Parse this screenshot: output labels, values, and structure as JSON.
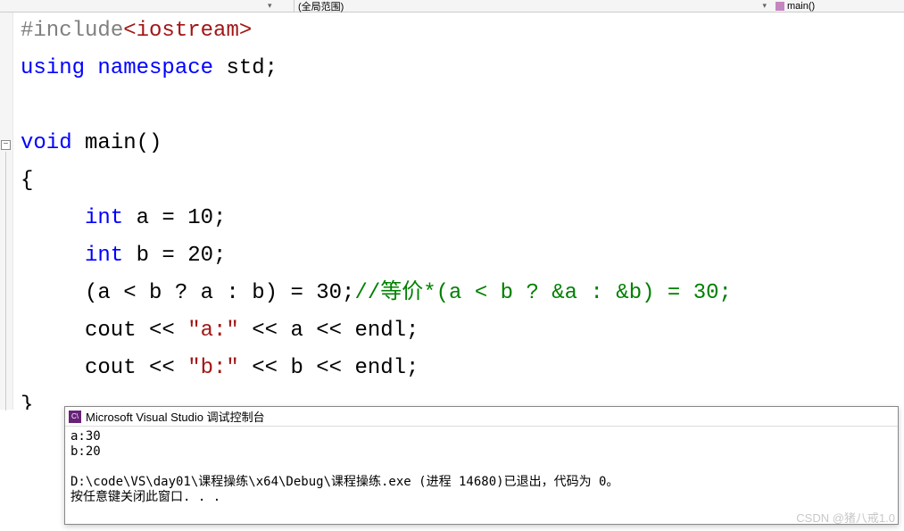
{
  "topbar": {
    "scope_label": "(全局范围)",
    "func_label": "main()"
  },
  "code": {
    "l1_include": "#include",
    "l1_header": "<iostream>",
    "l2_using": "using",
    "l2_namespace": "namespace",
    "l2_std": " std;",
    "l4_void": "void",
    "l4_main": " main()",
    "l5_brace": "{",
    "l6_int": "int",
    "l6_rest": " a = 10;",
    "l7_int": "int",
    "l7_rest": " b = 20;",
    "l8_expr": "(a < b ? a : b) = 30;",
    "l8_comment": "//等价*(a < b ? &a : &b) = 30;",
    "l9_cout": "cout << ",
    "l9_str": "\"a:\"",
    "l9_rest": " << a << endl;",
    "l10_cout": "cout << ",
    "l10_str": "\"b:\"",
    "l10_rest": " << b << endl;",
    "l11_brace": "}"
  },
  "console": {
    "title": "Microsoft Visual Studio 调试控制台",
    "line1": "a:30",
    "line2": "b:20",
    "line4": "D:\\code\\VS\\day01\\课程操练\\x64\\Debug\\课程操练.exe (进程 14680)已退出，代码为 0。",
    "line5": "按任意键关闭此窗口. . ."
  },
  "watermark": "CSDN @猪八戒1.0"
}
